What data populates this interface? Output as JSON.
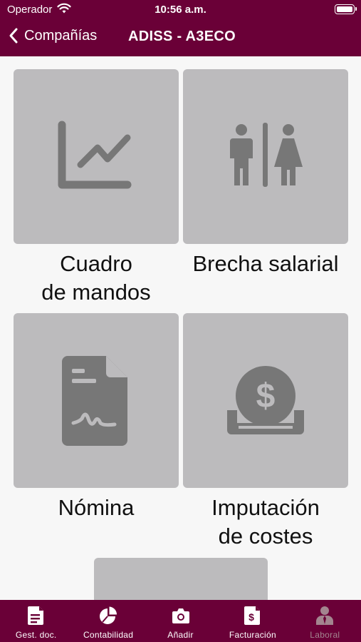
{
  "status_bar": {
    "carrier": "Operador",
    "time": "10:56 a.m."
  },
  "nav": {
    "back_label": "Compañías",
    "title": "ADISS - A3ECO"
  },
  "tiles": [
    {
      "label": "Cuadro\nde mandos",
      "icon": "line-chart-icon"
    },
    {
      "label": "Brecha salarial",
      "icon": "gender-gap-icon"
    },
    {
      "label": "Nómina",
      "icon": "payroll-document-icon"
    },
    {
      "label": "Imputación\nde costes",
      "icon": "dollar-coin-icon"
    },
    {
      "label": "",
      "icon": ""
    }
  ],
  "tabbar": {
    "items": [
      {
        "label": "Gest. doc.",
        "icon": "document-icon",
        "active": true
      },
      {
        "label": "Contabilidad",
        "icon": "pie-chart-icon",
        "active": true
      },
      {
        "label": "Añadir",
        "icon": "camera-icon",
        "active": true
      },
      {
        "label": "Facturación",
        "icon": "invoice-icon",
        "active": true
      },
      {
        "label": "Laboral",
        "icon": "person-icon",
        "active": false
      }
    ]
  },
  "colors": {
    "brand": "#6a0037",
    "tile": "#bcbbbd",
    "icon": "#777777",
    "background": "#f7f7f7"
  }
}
